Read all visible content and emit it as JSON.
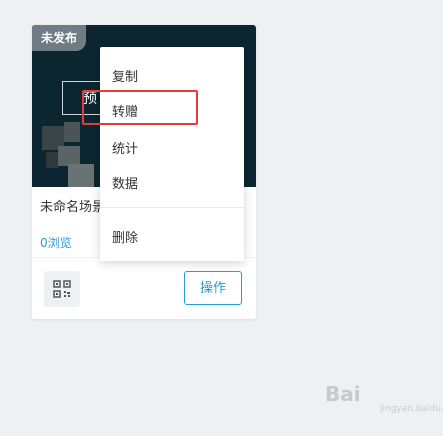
{
  "card": {
    "status_badge": "未发布",
    "preview_label": "预",
    "title": "未命名场景",
    "views": "0浏览",
    "operate_label": "操作"
  },
  "context_menu": {
    "items": [
      {
        "label": "复制"
      },
      {
        "label": "转赠"
      },
      {
        "label": "统计"
      },
      {
        "label": "数据"
      },
      {
        "label": "删除"
      }
    ]
  },
  "watermark": {
    "brand": "Bai",
    "subtext": "jingyan.baidu.com"
  },
  "colors": {
    "accent": "#2a9ad8",
    "highlight": "#e23c3c",
    "cover_bg": "#0b2531",
    "page_bg": "#eef1f3"
  },
  "icons": {
    "qr": "qr-code-icon"
  }
}
